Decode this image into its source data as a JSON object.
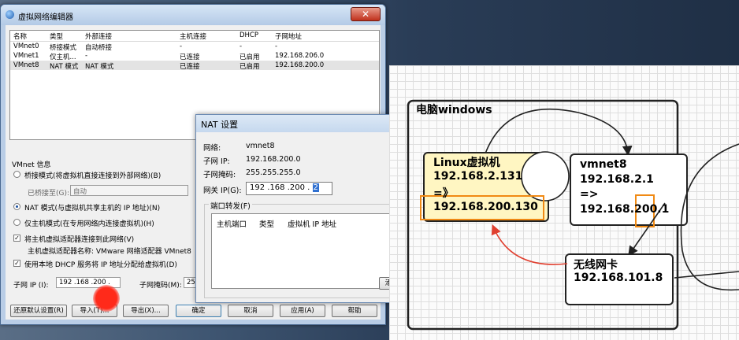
{
  "vne": {
    "title": "虚拟网络编辑器",
    "close": "✕",
    "columns": [
      "名称",
      "类型",
      "外部连接",
      "主机连接",
      "DHCP",
      "子网地址"
    ],
    "rows": [
      {
        "name": "VMnet0",
        "type": "桥接模式",
        "ext": "自动桥接",
        "host": "-",
        "dhcp": "-",
        "subnet": "-"
      },
      {
        "name": "VMnet1",
        "type": "仅主机...",
        "ext": "-",
        "host": "已连接",
        "dhcp": "已启用",
        "subnet": "192.168.206.0"
      },
      {
        "name": "VMnet8",
        "type": "NAT 模式",
        "ext": "NAT 模式",
        "host": "已连接",
        "dhcp": "已启用",
        "subnet": "192.168.200.0"
      }
    ],
    "info_title": "VMnet 信息",
    "bridge_radio": "桥接模式(将虚拟机直接连接到外部网络)(B)",
    "bridged_to_label": "已桥接至(G):",
    "bridged_to_value": "自动",
    "nat_radio": "NAT 模式(与虚拟机共享主机的 IP 地址)(N)",
    "host_only_radio": "仅主机模式(在专用网络内连接虚拟机)(H)",
    "connect_adapter_check": "将主机虚拟适配器连接到此网络(V)",
    "adapter_name": "主机虚拟适配器名称: VMware 网络适配器 VMnet8",
    "dhcp_check": "使用本地 DHCP 服务将 IP 地址分配给虚拟机(D)",
    "subnet_ip_label": "子网 IP (I):",
    "subnet_ip_value": "192 .168 .200 .",
    "mask_label": "子网掩码(M):",
    "mask_value": "25",
    "buttons": {
      "restore": "还原默认设置(R)",
      "import": "导入(T)...",
      "export": "导出(X)...",
      "ok": "确定",
      "cancel": "取消",
      "apply": "应用(A)",
      "help": "帮助"
    }
  },
  "nat": {
    "title": "NAT 设置",
    "network_label": "网络:",
    "network_value": "vmnet8",
    "subnet_ip_label": "子网 IP:",
    "subnet_ip_value": "192.168.200.0",
    "subnet_mask_label": "子网掩码:",
    "subnet_mask_value": "255.255.255.0",
    "gateway_label": "网关 IP(G):",
    "gateway_prefix": "192 .168 .200 .",
    "gateway_last": "2",
    "port_forward_label": "端口转发(F)",
    "columns": [
      "主机端口",
      "类型",
      "虚拟机 IP 地址"
    ],
    "add_button": "添"
  },
  "diagram": {
    "pc_title": "电脑windows",
    "linux_box": [
      "Linux虚拟机",
      "192.168.2.131",
      "=》",
      "192.168.200.130"
    ],
    "vmnet_box": [
      "vmnet8",
      "192.168.2.1",
      "=>",
      "192.168.200.1"
    ],
    "wifi_box": [
      "无线网卡",
      "192.168.101.8"
    ],
    "colors": {
      "linux_fill": "#fff6c2",
      "orange": "#f08a14",
      "red_arrow": "#e04030"
    }
  }
}
